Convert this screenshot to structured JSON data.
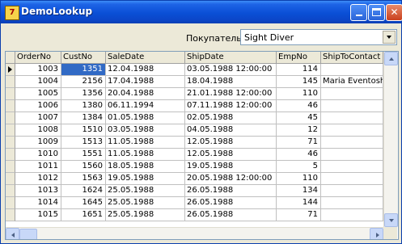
{
  "window": {
    "title": "DemoLookup",
    "icon": "delphi-app-icon"
  },
  "titlebar_buttons": {
    "minimize": "minimize-icon",
    "maximize": "maximize-icon",
    "close": "close-icon",
    "close_glyph": "✕"
  },
  "filter": {
    "label": "Покупатель:",
    "value": "Sight Diver"
  },
  "grid": {
    "columns": [
      "OrderNo",
      "CustNo",
      "SaleDate",
      "ShipDate",
      "EmpNo",
      "ShipToContact"
    ],
    "rows": [
      [
        "1003",
        "1351",
        "12.04.1988",
        "03.05.1988 12:00:00",
        "114",
        ""
      ],
      [
        "1004",
        "2156",
        "17.04.1988",
        "18.04.1988",
        "145",
        "Maria Eventosh"
      ],
      [
        "1005",
        "1356",
        "20.04.1988",
        "21.01.1988 12:00:00",
        "110",
        ""
      ],
      [
        "1006",
        "1380",
        "06.11.1994",
        "07.11.1988 12:00:00",
        "46",
        ""
      ],
      [
        "1007",
        "1384",
        "01.05.1988",
        "02.05.1988",
        "45",
        ""
      ],
      [
        "1008",
        "1510",
        "03.05.1988",
        "04.05.1988",
        "12",
        ""
      ],
      [
        "1009",
        "1513",
        "11.05.1988",
        "12.05.1988",
        "71",
        ""
      ],
      [
        "1010",
        "1551",
        "11.05.1988",
        "12.05.1988",
        "46",
        ""
      ],
      [
        "1011",
        "1560",
        "18.05.1988",
        "19.05.1988",
        "5",
        ""
      ],
      [
        "1012",
        "1563",
        "19.05.1988",
        "20.05.1988 12:00:00",
        "110",
        ""
      ],
      [
        "1013",
        "1624",
        "25.05.1988",
        "26.05.1988",
        "134",
        ""
      ],
      [
        "1014",
        "1645",
        "25.05.1988",
        "26.05.1988",
        "144",
        ""
      ],
      [
        "1015",
        "1651",
        "25.05.1988",
        "26.05.1988",
        "71",
        ""
      ]
    ],
    "current_row": 0,
    "selected_column": 1
  }
}
